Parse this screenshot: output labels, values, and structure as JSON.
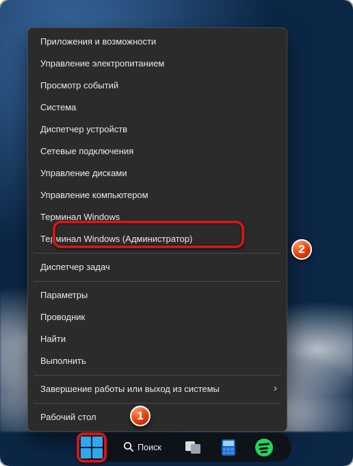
{
  "menu": {
    "items": [
      {
        "label": "Приложения и возможности"
      },
      {
        "label": "Управление электропитанием"
      },
      {
        "label": "Просмотр событий"
      },
      {
        "label": "Система"
      },
      {
        "label": "Диспетчер устройств"
      },
      {
        "label": "Сетевые подключения"
      },
      {
        "label": "Управление дисками"
      },
      {
        "label": "Управление компьютером"
      },
      {
        "label": "Терминал Windows"
      },
      {
        "label": "Терминал Windows (Администратор)"
      },
      {
        "label": "Диспетчер задач"
      },
      {
        "label": "Параметры"
      },
      {
        "label": "Проводник"
      },
      {
        "label": "Найти"
      },
      {
        "label": "Выполнить"
      },
      {
        "label": "Завершение работы или выход из системы"
      },
      {
        "label": "Рабочий стол"
      }
    ],
    "highlighted_index": 9
  },
  "taskbar": {
    "search_label": "Поиск"
  },
  "annotations": {
    "badge1": "1",
    "badge2": "2"
  },
  "colors": {
    "highlight": "#d01818",
    "menu_bg": "#2b2b2b",
    "accent_blue": "#2fa8ee",
    "spotify_green": "#1ed760"
  }
}
